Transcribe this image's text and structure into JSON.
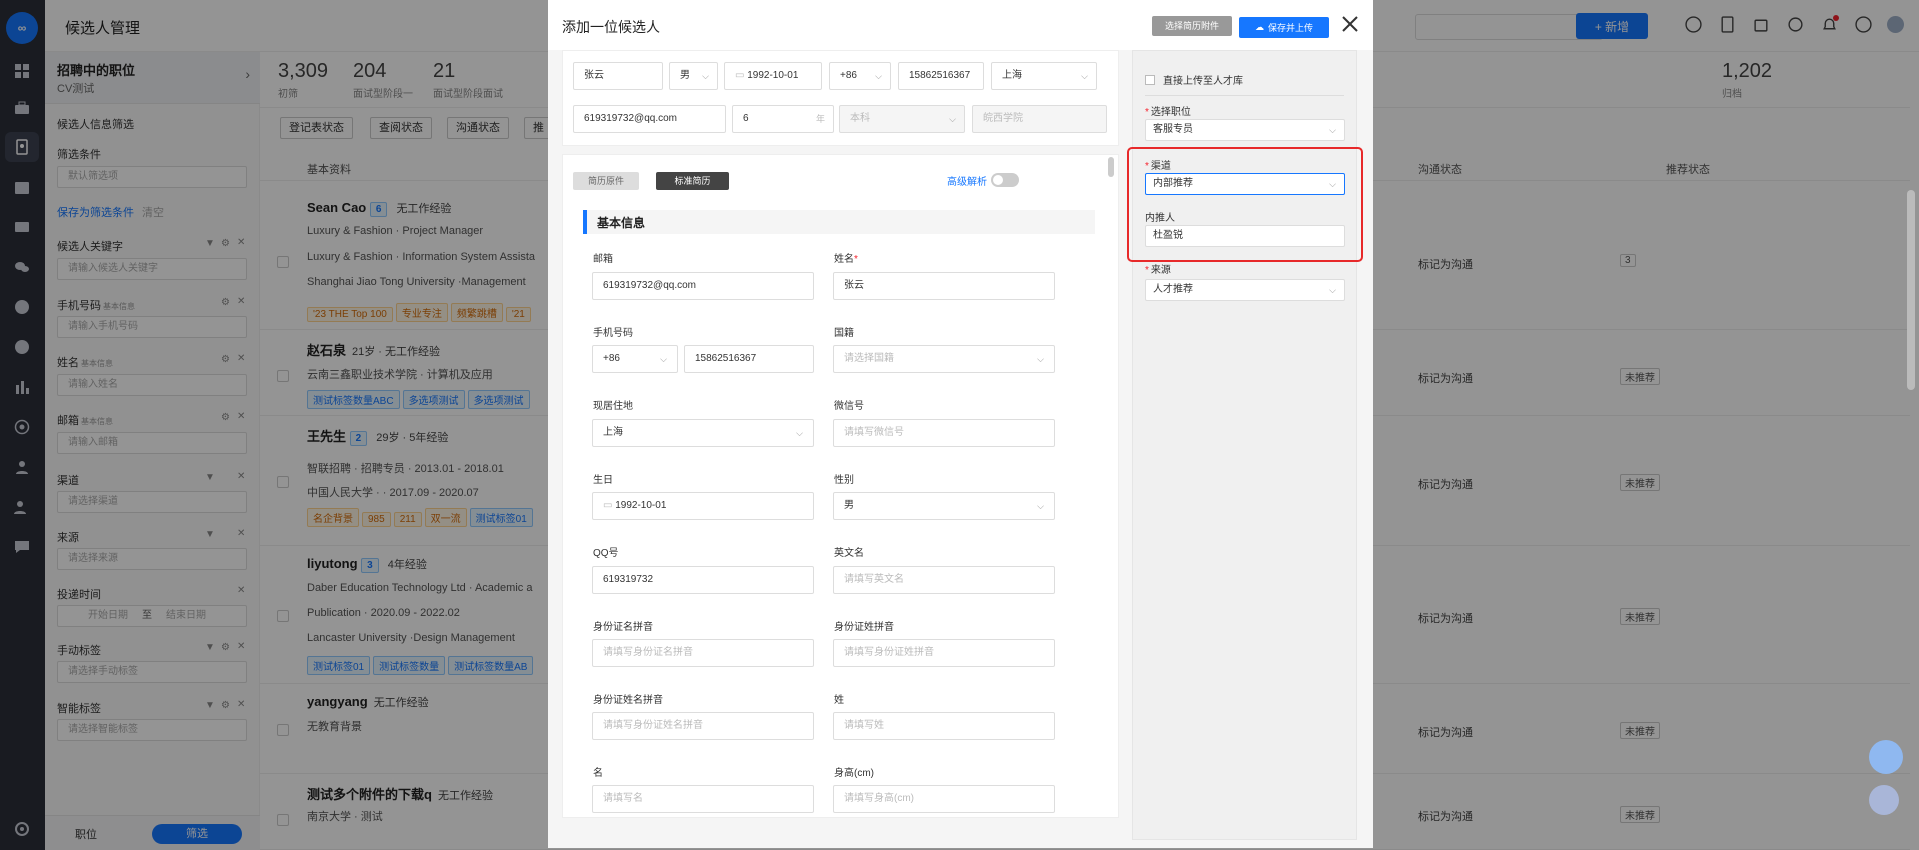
{
  "header": {
    "title": "候选人管理",
    "new_button": "+ 新增"
  },
  "rail": {
    "logo_text": "∞",
    "icons": [
      "dashboard-icon",
      "briefcase-icon",
      "candidate-icon",
      "calendar-icon",
      "id-card-icon",
      "wechat-icon",
      "star-icon",
      "chart-pie-icon",
      "bar-chart-icon",
      "at-icon",
      "user-icon",
      "user-group-icon",
      "message-icon",
      "settings-icon"
    ]
  },
  "filter": {
    "job": {
      "title": "招聘中的职位",
      "subtitle": "CV测试"
    },
    "section_title": "候选人信息筛选",
    "condition_label": "筛选条件",
    "condition_value": "默认筛选项",
    "save_link": "保存为筛选条件",
    "clear_link": "清空",
    "keyword_label": "候选人关键字",
    "keyword_placeholder": "请输入候选人关键字",
    "phone_label": "手机号码",
    "phone_tag": "基本信息",
    "phone_placeholder": "请输入手机号码",
    "name_label": "姓名",
    "name_tag": "基本信息",
    "name_placeholder": "请输入姓名",
    "email_label": "邮箱",
    "email_tag": "基本信息",
    "email_placeholder": "请输入邮箱",
    "channel_label": "渠道",
    "channel_placeholder": "请选择渠道",
    "source_label": "来源",
    "source_placeholder": "请选择来源",
    "time_label": "投递时间",
    "start_date": "开始日期",
    "to": "至",
    "end_date": "结束日期",
    "manual_tag_label": "手动标签",
    "manual_tag_placeholder": "请选择手动标签",
    "smart_tag_label": "智能标签",
    "smart_tag_placeholder": "请选择智能标签",
    "bottom_jobs": "职位",
    "bottom_filter": "筛选"
  },
  "stats": [
    {
      "n": "3,309",
      "l": "初筛"
    },
    {
      "n": "204",
      "l": "面试型阶段一"
    },
    {
      "n": "21",
      "l": "面试型阶段面试"
    },
    {
      "n": "1,202",
      "l": "归档"
    }
  ],
  "toolbar": [
    "登记表状态",
    "查阅状态",
    "沟通状态",
    "推"
  ],
  "table_head": {
    "c1": "基本资料",
    "c2": "沟通状态",
    "c3": "推荐状态"
  },
  "candidates": [
    {
      "name": "Sean Cao",
      "badge": "6",
      "meta": "无工作经验",
      "lines": [
        "Luxury & Fashion · Project Manager",
        "Luxury & Fashion · Information System Assista",
        "Shanghai Jiao Tong University ·Management"
      ],
      "tags": [
        "'23 THE Top 100",
        "专业专注",
        "频繁跳槽",
        "'21"
      ],
      "status": "标记为沟通",
      "rec": "3"
    },
    {
      "name": "赵石泉",
      "meta": "21岁 · 无工作经验",
      "lines": [
        "云南三鑫职业技术学院 · 计算机及应用"
      ],
      "tags": [
        "测试标签数量ABC",
        "多选项测试",
        "多选项测试"
      ],
      "status": "标记为沟通",
      "rec": "未推荐"
    },
    {
      "name": "王先生",
      "badge": "2",
      "meta": "29岁 · 5年经验",
      "lines": [
        "智联招聘 · 招聘专员 · 2013.01 - 2018.01",
        "中国人民大学 · · 2017.09 - 2020.07"
      ],
      "tags": [
        "名企背景",
        "985",
        "211",
        "双一流",
        "测试标签01"
      ],
      "status": "标记为沟通",
      "rec": "未推荐"
    },
    {
      "name": "liyutong",
      "badge": "3",
      "meta": "4年经验",
      "lines": [
        "Daber Education Technology Ltd · Academic a",
        "Publication · 2020.09 - 2022.02",
        "Lancaster University ·Design Management"
      ],
      "tags": [
        "测试标签01",
        "测试标签数量",
        "测试标签数量AB"
      ],
      "status": "标记为沟通",
      "rec": "未推荐"
    },
    {
      "name": "yangyang",
      "meta": "无工作经验",
      "lines": [
        "无教育背景"
      ],
      "tags": [],
      "status": "标记为沟通",
      "rec": "未推荐"
    },
    {
      "name": "测试多个附件的下载q",
      "meta": "无工作经验",
      "lines": [
        "南京大学 · 测试"
      ],
      "tags": [],
      "status": "标记为沟通",
      "rec": "未推荐"
    }
  ],
  "modal": {
    "title": "添加一位候选人",
    "attach_button": "选择简历附件",
    "save_button": "保存并上传",
    "top": {
      "name": "张云",
      "gender": "男",
      "birthday": "1992-10-01",
      "code": "+86",
      "phone": "15862516367",
      "city": "上海",
      "email": "619319732@qq.com",
      "years": "6",
      "years_unit": "年",
      "degree": "本科",
      "school": "皖西学院"
    },
    "tab_original": "简历原件",
    "tab_standard": "标准简历",
    "advanced": "高级解析",
    "section": "基本信息",
    "fields": {
      "email_label": "邮箱",
      "email": "619319732@qq.com",
      "name_label": "姓名",
      "name": "张云",
      "phone_label": "手机号码",
      "code": "+86",
      "phone": "15862516367",
      "nationality_label": "国籍",
      "nationality_ph": "请选择国籍",
      "residence_label": "现居住地",
      "residence": "上海",
      "wechat_label": "微信号",
      "wechat_ph": "请填写微信号",
      "birthday_label": "生日",
      "birthday": "1992-10-01",
      "gender_label": "性别",
      "gender": "男",
      "qq_label": "QQ号",
      "qq": "619319732",
      "en_name_label": "英文名",
      "en_name_ph": "请填写英文名",
      "id_name_py_label": "身份证名拼音",
      "id_name_py_ph": "请填写身份证名拼音",
      "id_surname_py_label": "身份证姓拼音",
      "id_surname_py_ph": "请填写身份证姓拼音",
      "id_fullname_py_label": "身份证姓名拼音",
      "id_fullname_py_ph": "请填写身份证姓名拼音",
      "surname_label": "姓",
      "surname_ph": "请填写姓",
      "given_label": "名",
      "given_ph": "请填写名",
      "height_label": "身高(cm)",
      "height_ph": "请填写身高(cm)"
    },
    "right": {
      "direct_upload": "直接上传至人才库",
      "position_label": "选择职位",
      "position": "客服专员",
      "channel_label": "渠道",
      "channel": "内部推荐",
      "referrer_label": "内推人",
      "referrer": "杜盈锐",
      "source_label": "来源",
      "source": "人才推荐"
    }
  }
}
